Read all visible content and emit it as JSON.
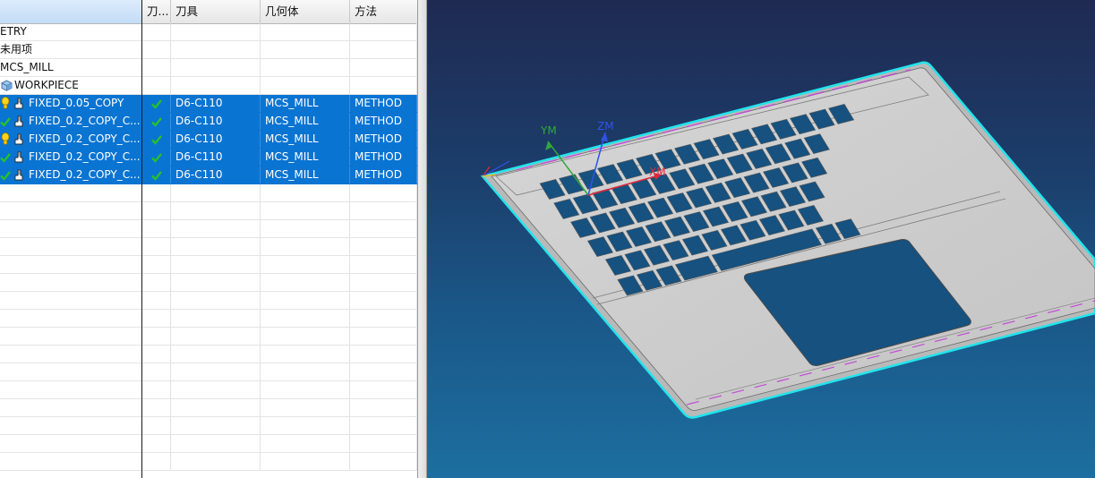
{
  "navigator": {
    "columns": {
      "name": "",
      "path": "刀...",
      "tool": "刀具",
      "geometry": "几何体",
      "method": "方法"
    },
    "tree": [
      {
        "name": "ETRY"
      },
      {
        "name": "未用项"
      },
      {
        "name": "MCS_MILL"
      },
      {
        "name": "WORKPIECE"
      }
    ],
    "operations": [
      {
        "status": "warning",
        "name": "FIXED_0.05_COPY",
        "tool": "D6-C110",
        "geometry": "MCS_MILL",
        "method": "METHOD"
      },
      {
        "status": "ok",
        "name": "FIXED_0.2_COPY_C...",
        "tool": "D6-C110",
        "geometry": "MCS_MILL",
        "method": "METHOD"
      },
      {
        "status": "warning",
        "name": "FIXED_0.2_COPY_C...",
        "tool": "D6-C110",
        "geometry": "MCS_MILL",
        "method": "METHOD"
      },
      {
        "status": "ok",
        "name": "FIXED_0.2_COPY_C...",
        "tool": "D6-C110",
        "geometry": "MCS_MILL",
        "method": "METHOD"
      },
      {
        "status": "ok",
        "name": "FIXED_0.2_COPY_C...",
        "tool": "D6-C110",
        "geometry": "MCS_MILL",
        "method": "METHOD"
      }
    ],
    "icons": {
      "warning": "warning-bulb-icon",
      "ok": "check-icon",
      "operation": "mill-operation-icon",
      "workpiece": "workpiece-icon"
    }
  },
  "viewport": {
    "axes": {
      "x": "XM",
      "y": "YM",
      "z": "ZM"
    },
    "colors": {
      "x_axis": "#e0283a",
      "y_axis": "#31a83a",
      "z_axis": "#2f54e8",
      "part": "#c8c8c8",
      "cutout": "#16517f",
      "edge_highlight": "#22e4ec"
    }
  }
}
